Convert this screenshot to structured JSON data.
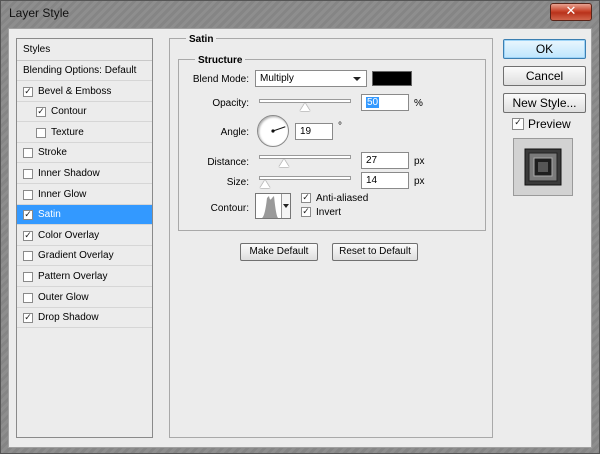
{
  "window": {
    "title": "Layer Style",
    "close_glyph": "✕"
  },
  "sidebar": {
    "header": "Styles",
    "items": [
      {
        "label": "Blending Options: Default",
        "checkbox": false,
        "checked": false,
        "indent": false,
        "selected": false
      },
      {
        "label": "Bevel & Emboss",
        "checkbox": true,
        "checked": true,
        "indent": false,
        "selected": false
      },
      {
        "label": "Contour",
        "checkbox": true,
        "checked": true,
        "indent": true,
        "selected": false
      },
      {
        "label": "Texture",
        "checkbox": true,
        "checked": false,
        "indent": true,
        "selected": false
      },
      {
        "label": "Stroke",
        "checkbox": true,
        "checked": false,
        "indent": false,
        "selected": false
      },
      {
        "label": "Inner Shadow",
        "checkbox": true,
        "checked": false,
        "indent": false,
        "selected": false
      },
      {
        "label": "Inner Glow",
        "checkbox": true,
        "checked": false,
        "indent": false,
        "selected": false
      },
      {
        "label": "Satin",
        "checkbox": true,
        "checked": true,
        "indent": false,
        "selected": true
      },
      {
        "label": "Color Overlay",
        "checkbox": true,
        "checked": true,
        "indent": false,
        "selected": false
      },
      {
        "label": "Gradient Overlay",
        "checkbox": true,
        "checked": false,
        "indent": false,
        "selected": false
      },
      {
        "label": "Pattern Overlay",
        "checkbox": true,
        "checked": false,
        "indent": false,
        "selected": false
      },
      {
        "label": "Outer Glow",
        "checkbox": true,
        "checked": false,
        "indent": false,
        "selected": false
      },
      {
        "label": "Drop Shadow",
        "checkbox": true,
        "checked": true,
        "indent": false,
        "selected": false
      }
    ]
  },
  "satin": {
    "title": "Satin",
    "structure_title": "Structure",
    "blend_mode_label": "Blend Mode:",
    "blend_mode_value": "Multiply",
    "blend_color": "#000000",
    "opacity_label": "Opacity:",
    "opacity_value": "50",
    "opacity_percent": 50,
    "percent_unit": "%",
    "angle_label": "Angle:",
    "angle_value": "19",
    "degree_unit": "°",
    "distance_label": "Distance:",
    "distance_value": "27",
    "distance_slider_fraction": 0.27,
    "size_label": "Size:",
    "size_value": "14",
    "size_slider_fraction": 0.06,
    "px_unit": "px",
    "contour_label": "Contour:",
    "anti_aliased_label": "Anti-aliased",
    "anti_aliased_checked": true,
    "invert_label": "Invert",
    "invert_checked": true,
    "make_default_label": "Make Default",
    "reset_default_label": "Reset to Default"
  },
  "actions": {
    "ok_label": "OK",
    "cancel_label": "Cancel",
    "new_style_label": "New Style...",
    "preview_label": "Preview",
    "preview_checked": true
  },
  "colors": {
    "accent": "#3399ff",
    "check": "✓"
  }
}
